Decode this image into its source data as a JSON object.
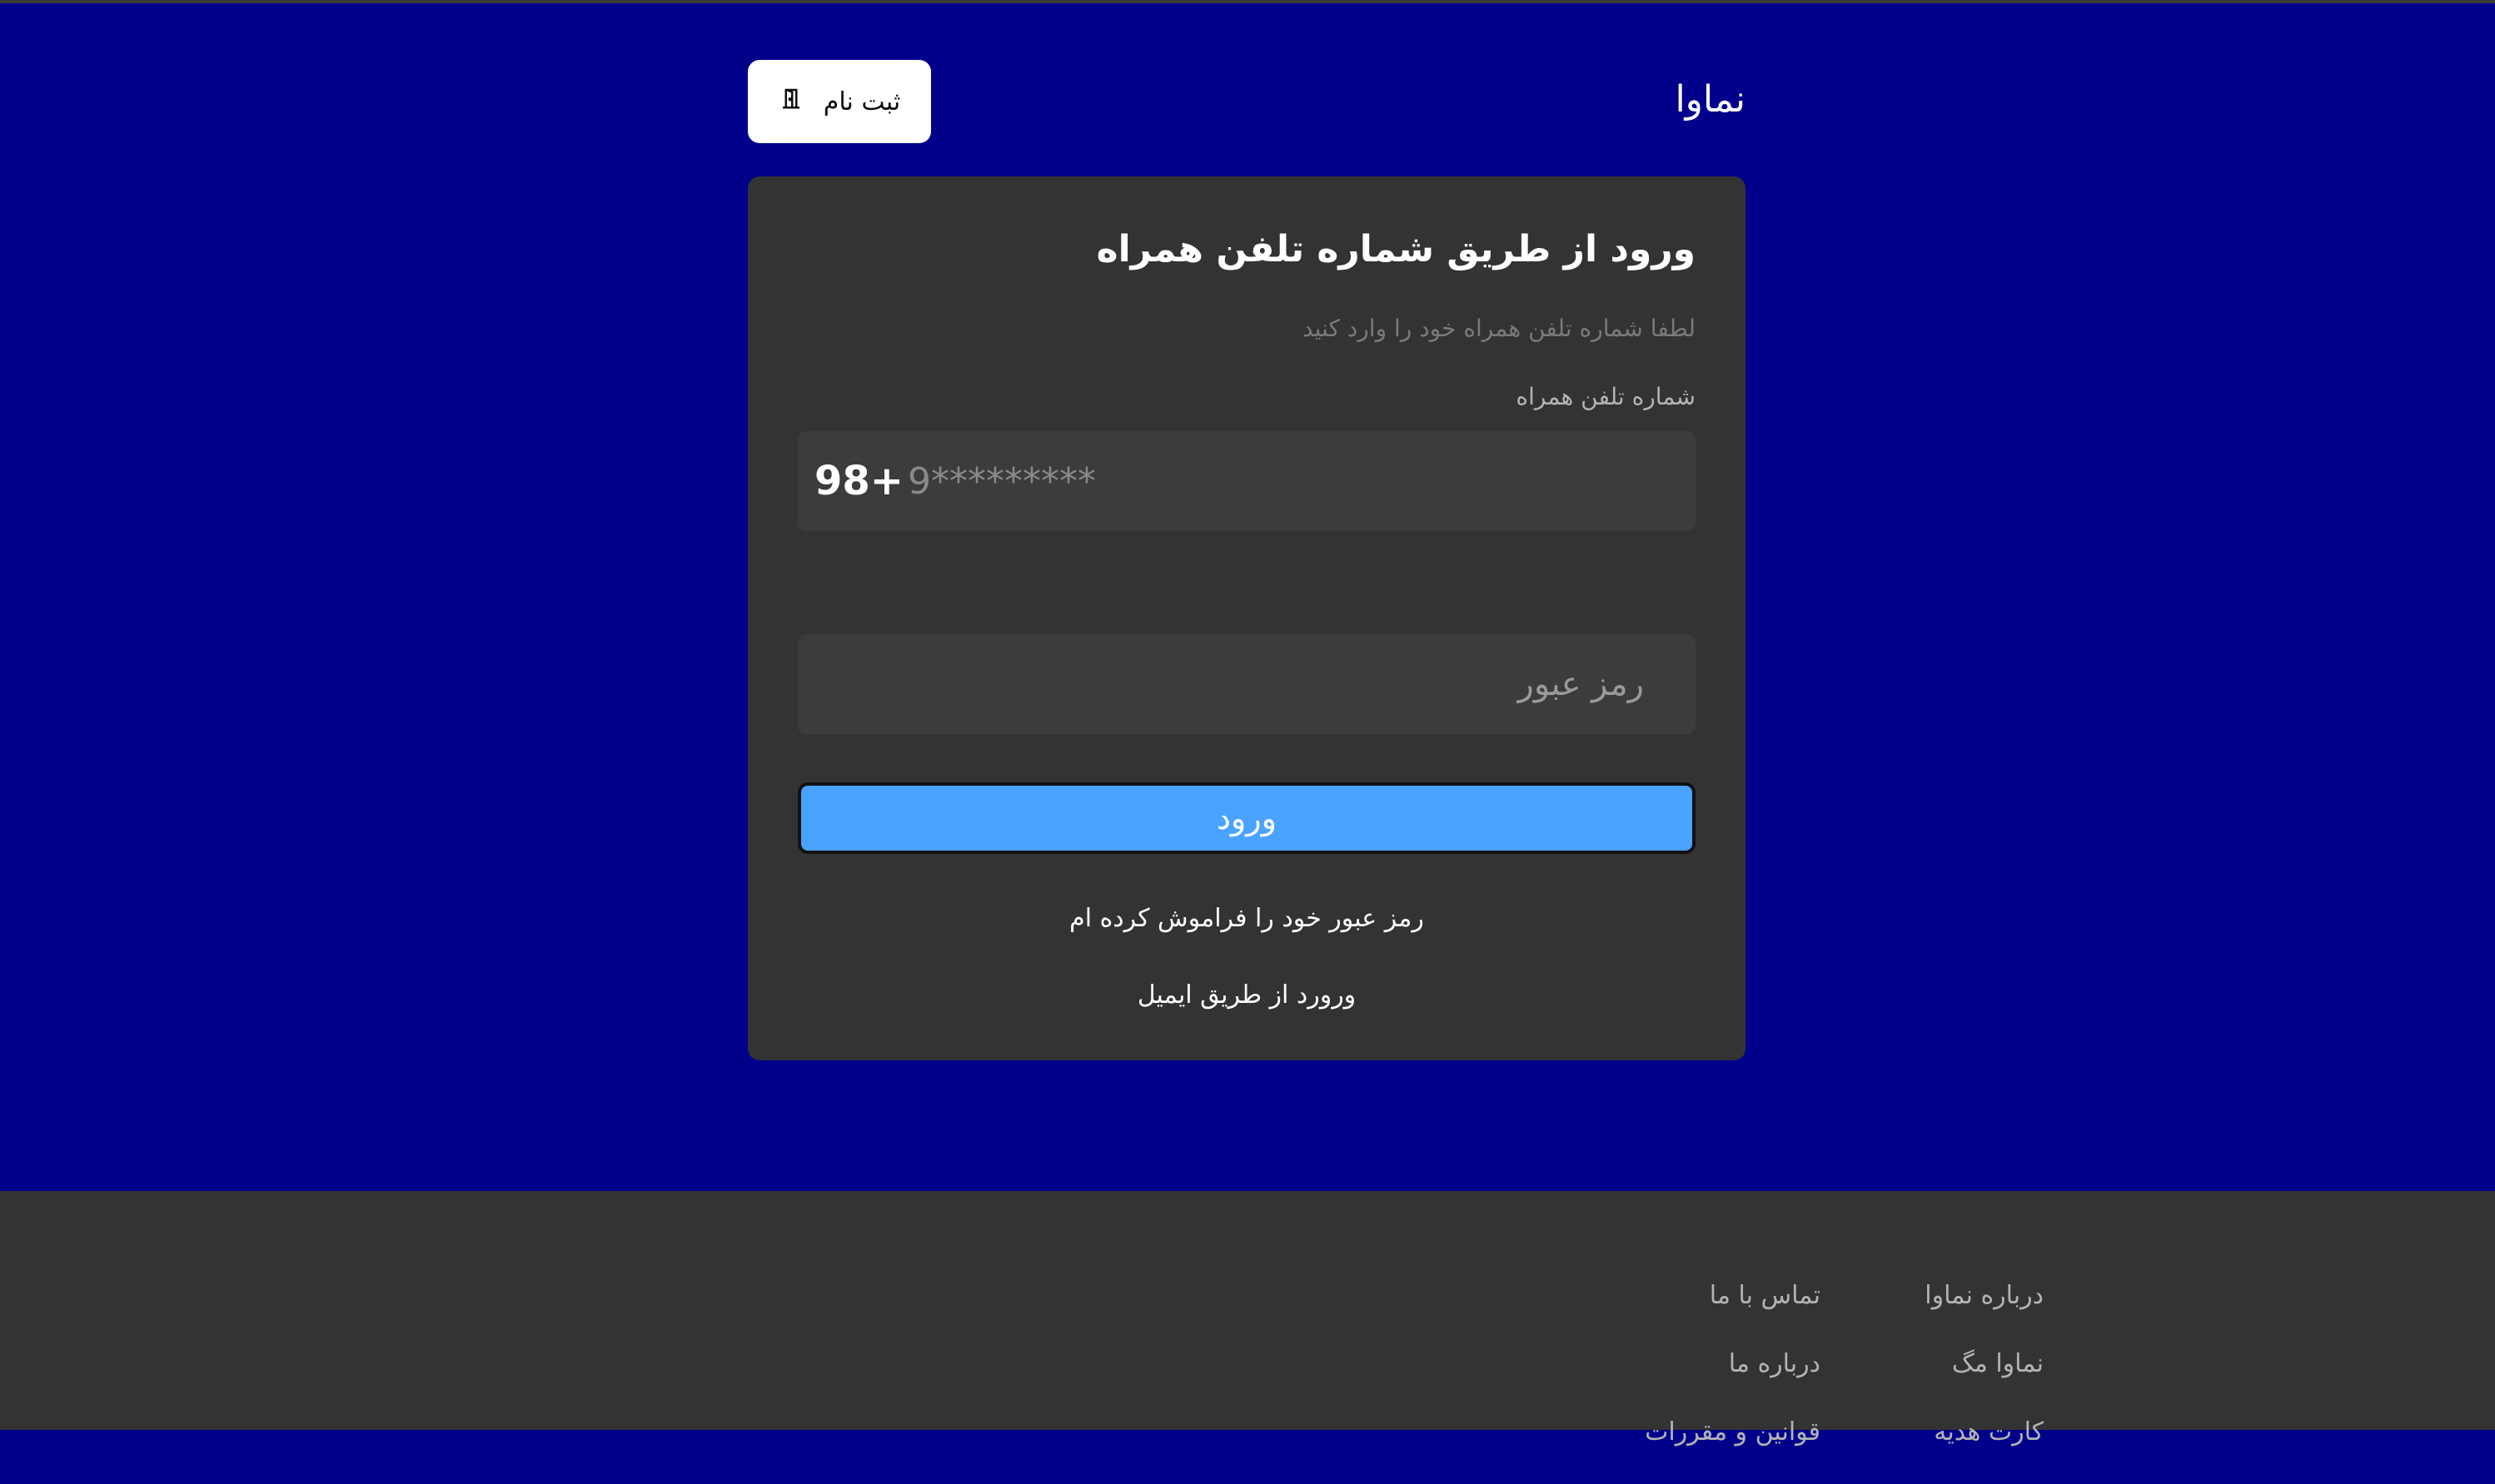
{
  "header": {
    "brand": "نماوا",
    "register_label": "ثبت نام",
    "register_icon": "door-icon"
  },
  "login": {
    "title": "ورود از طریق شماره تلفن همراه",
    "subtitle": "لطفا شماره تلفن همراه خود را وارد کنید",
    "phone_label": "شماره تلفن همراه",
    "phone_prefix": "98+",
    "phone_placeholder": "9*********",
    "phone_value": "",
    "password_placeholder": "رمز عبور",
    "password_value": "",
    "submit_label": "ورود",
    "forgot_password": "رمز عبور خود را فراموش کرده ام",
    "email_login": "ورورد از طریق ایمیل"
  },
  "footer": {
    "column1": [
      "درباره نماوا",
      "نماوا مگ",
      "کارت هدیه"
    ],
    "column2": [
      "تماس با ما",
      "درباره ما",
      "قوانین و مقررات"
    ]
  },
  "colors": {
    "background": "#00008b",
    "card": "#333333",
    "button": "#4aa3ff",
    "footer": "#333333"
  }
}
